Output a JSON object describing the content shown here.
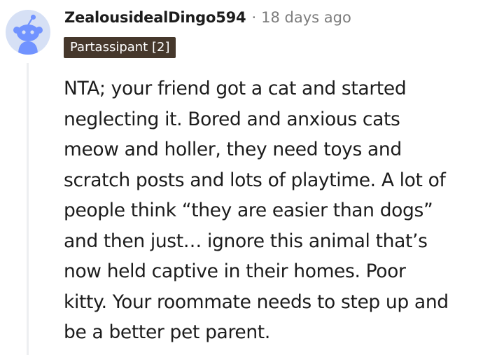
{
  "comment": {
    "username": "ZealousidealDingo594",
    "separator": "·",
    "timestamp": "18 days ago",
    "flair": "Partassipant [2]",
    "body_lines": [
      "NTA; your friend got a cat and started",
      "neglecting it. Bored and anxious cats",
      "meow and holler, they need toys and",
      "scratch posts and lots of playtime. A lot of",
      "people think “they are easier than dogs”",
      "and then just… ignore this animal that’s",
      "now held captive in their homes. Poor",
      "kitty. Your roommate needs to step up and",
      "be a better pet parent."
    ],
    "avatar_icon": "snoo-avatar-icon"
  },
  "colors": {
    "avatar_bg": "#d6e0f5",
    "snoo_body": "#7193ff",
    "flair_bg": "#46382c",
    "flair_text": "#ffffff",
    "meta_gray": "#7c7c7c",
    "text": "#1c1c1c",
    "thread_line": "#edeff1"
  }
}
